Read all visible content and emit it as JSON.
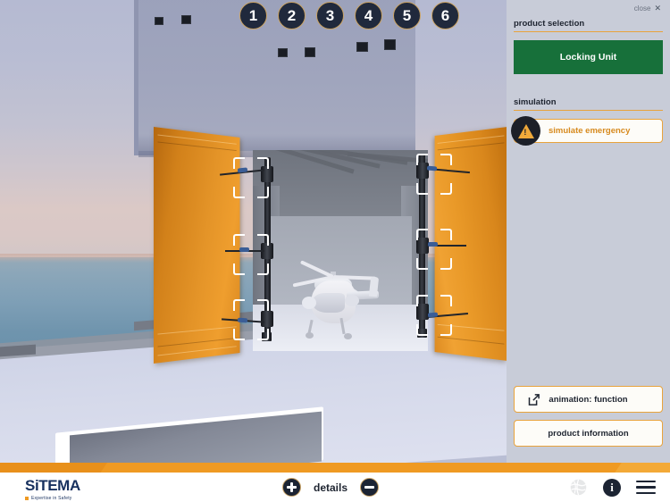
{
  "sidebar": {
    "close_label": "close",
    "close_icon": "close-icon",
    "product_selection_label": "product selection",
    "product_button_label": "Locking Unit",
    "simulation_label": "simulation",
    "simulate_button_label": "simulate emergency",
    "simulate_icon": "warning-triangle-icon",
    "animation_button_label": "animation: function",
    "animation_icon": "external-link-icon",
    "product_info_button_label": "product information"
  },
  "steps": [
    {
      "label": "1"
    },
    {
      "label": "2"
    },
    {
      "label": "3"
    },
    {
      "label": "4"
    },
    {
      "label": "5"
    },
    {
      "label": "6"
    }
  ],
  "footer": {
    "logo_text": "SiTEMA",
    "logo_tagline": "Expertise in Safety",
    "details_label": "details",
    "zoom_in_icon": "plus-circle-icon",
    "zoom_out_icon": "minus-circle-icon",
    "globe_icon": "globe-icon",
    "info_icon": "info-icon",
    "menu_icon": "hamburger-menu-icon"
  },
  "scene": {
    "description": "offshore-helideck-hangar-3d-view",
    "colors": {
      "door_orange": "#e4941f",
      "accent_orange": "#ef9a23",
      "sidebar_bg": "#c8ccd8",
      "product_green": "#17703a",
      "step_navy": "#20293c"
    }
  }
}
